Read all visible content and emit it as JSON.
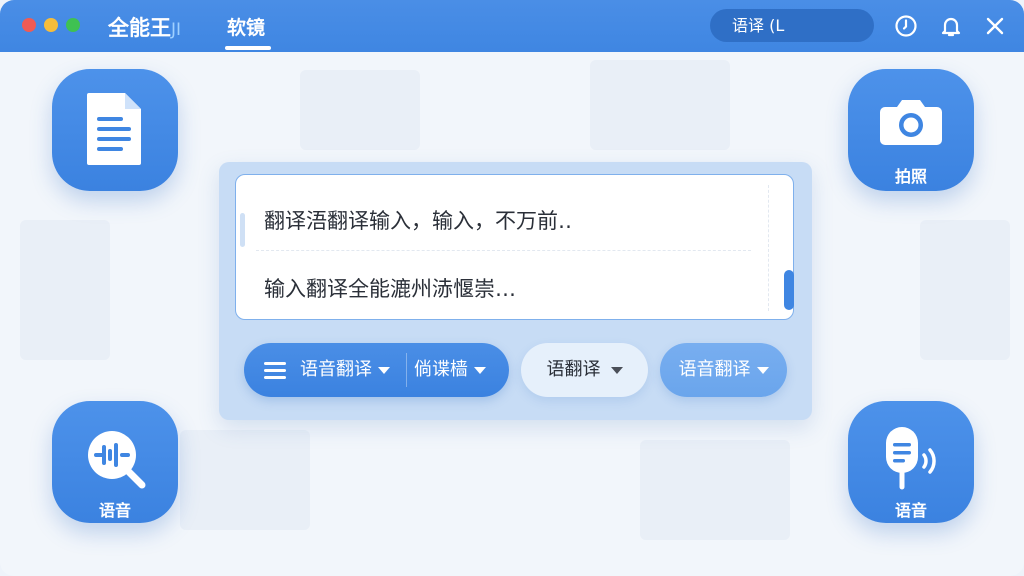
{
  "titlebar": {
    "app_name": "全能王",
    "app_name_suffix": "JI",
    "tab_label": "软镜",
    "search_value": "语译 (L"
  },
  "panel": {
    "text_lines": [
      "翻译浯翻译输入，输入，不万前‥",
      "输入翻译全能漉州浾愝崇…"
    ],
    "group_button_left": "语音翻译",
    "group_button_right": "倘谍樯",
    "light_button": "语翻译",
    "mid_button": "语音翻译"
  },
  "tiles": {
    "camera_label": "拍照",
    "voice_label": "语音",
    "mic_label": "语音"
  },
  "icons": {
    "document": "document-icon",
    "camera": "camera-icon",
    "voice_search": "voice-search-icon",
    "microphone": "microphone-icon",
    "clock": "clock-icon",
    "bell": "bell-icon",
    "close": "close-icon",
    "menu": "menu-icon",
    "dropdown": "chevron-down-icon"
  },
  "colors": {
    "accent": "#3f86e2",
    "titlebar": "#4a8ee6",
    "panel": "#c7dcf5"
  }
}
